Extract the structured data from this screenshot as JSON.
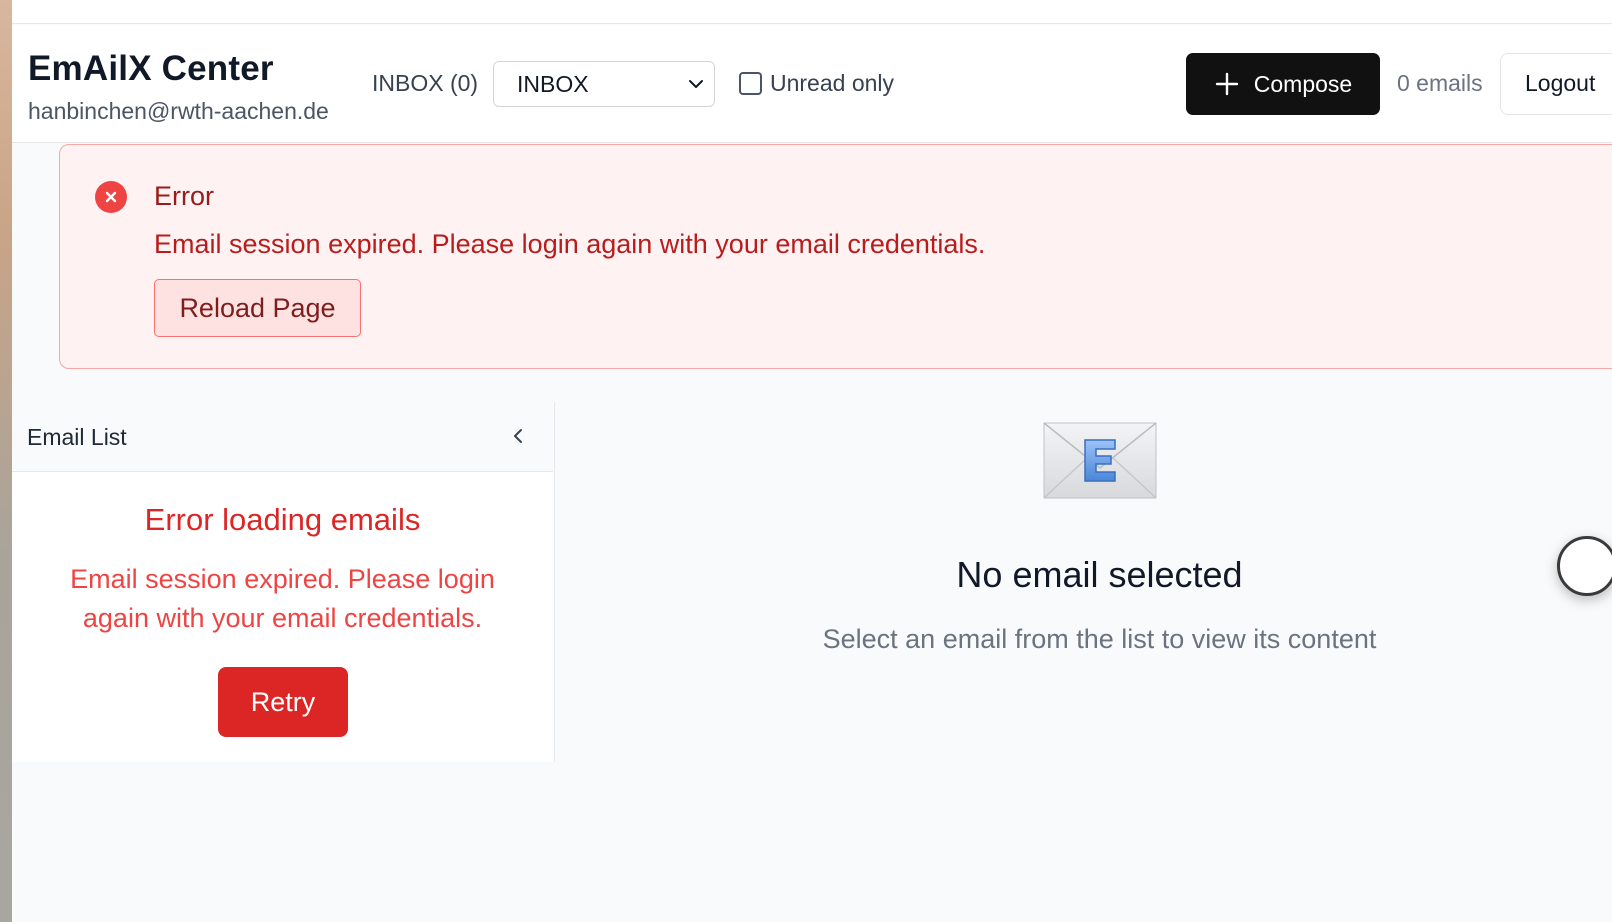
{
  "app": {
    "title": "EmAilX Center",
    "account_email": "hanbinchen@rwth-aachen.de"
  },
  "toolbar": {
    "folder_label": "INBOX (0)",
    "folder_select_value": "INBOX",
    "unread_only_label": "Unread only",
    "unread_only_checked": false,
    "compose_label": "Compose",
    "email_count": "0 emails",
    "logout_label": "Logout"
  },
  "alert": {
    "title": "Error",
    "message": "Email session expired. Please login again with your email credentials.",
    "reload_label": "Reload Page"
  },
  "email_list": {
    "header": "Email List",
    "error_title": "Error loading emails",
    "error_message": "Email session expired. Please login again with your email credentials.",
    "retry_label": "Retry"
  },
  "detail": {
    "title": "No email selected",
    "subtitle": "Select an email from the list to view its content",
    "placeholder_icon": "envelope-e-icon"
  },
  "colors": {
    "danger": "#dc2626",
    "danger_bg": "#fef2f2",
    "compose_bg": "#111111"
  }
}
